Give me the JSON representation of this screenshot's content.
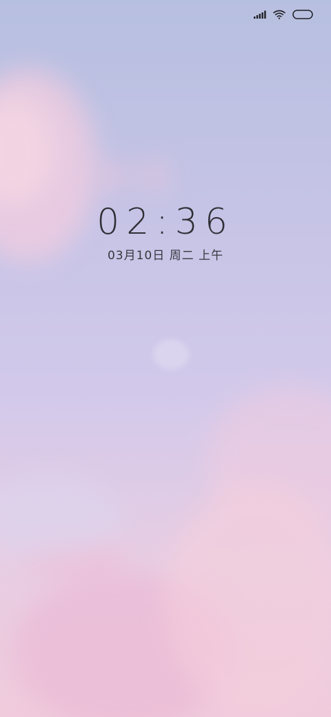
{
  "status_bar": {
    "icons": [
      "signal-icon",
      "wifi-icon",
      "battery-icon"
    ]
  },
  "lock_screen": {
    "time": "02:36",
    "date": "03月10日 周二 上午"
  },
  "wallpaper": {
    "description_colors": {
      "top": "#b7bfe0",
      "middle": "#d2c9ea",
      "bottom": "#f0cbdc",
      "cloud_pink": "#f3c6d8"
    }
  }
}
